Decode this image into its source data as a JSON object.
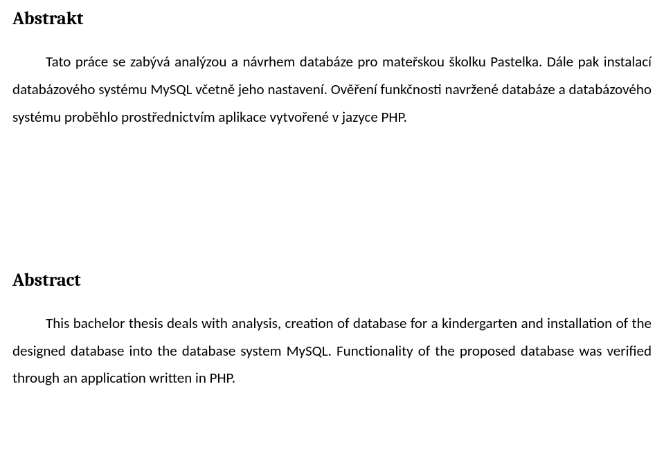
{
  "section1": {
    "heading": "Abstrakt",
    "paragraph": "Tato práce se zabývá analýzou a návrhem databáze pro mateřskou školku Pastelka. Dále pak instalací databázového systému MySQL včetně jeho nastavení. Ověření funkčnosti navržené databáze a databázového systému proběhlo prostřednictvím aplikace vytvořené v jazyce PHP."
  },
  "section2": {
    "heading": "Abstract",
    "paragraph": "This bachelor thesis deals with analysis, creation of database for a kindergarten and installation of the designed database into the database system MySQL. Functionality of the proposed database was verified through an application written in PHP."
  }
}
